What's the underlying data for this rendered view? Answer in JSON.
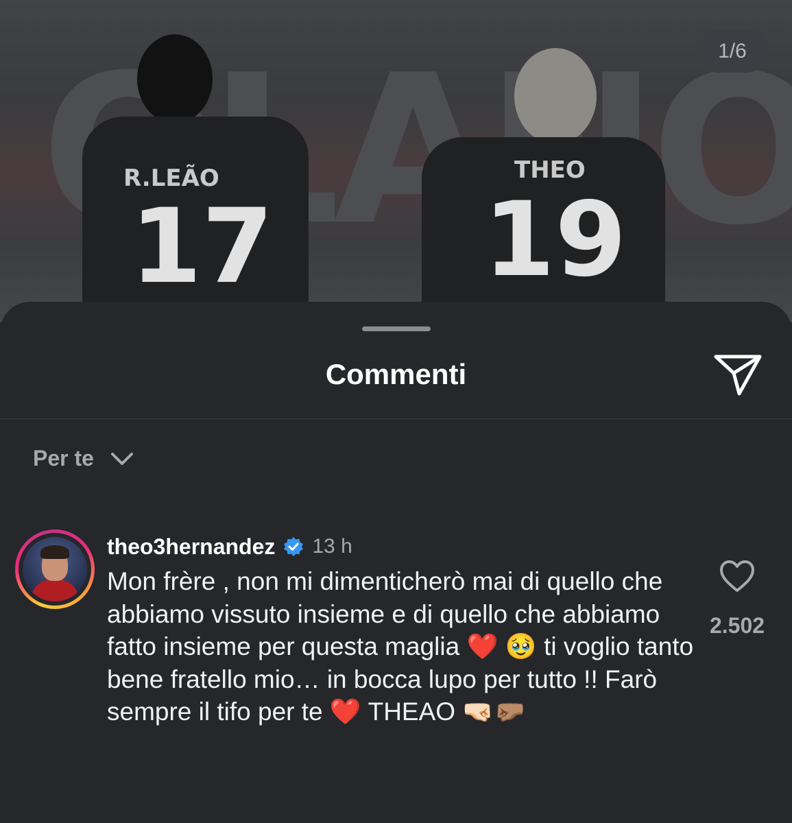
{
  "photo": {
    "counter": "1/6",
    "players": [
      {
        "name": "R.LEÃO",
        "number": "17"
      },
      {
        "name": "THEO",
        "number": "19"
      }
    ]
  },
  "sheet": {
    "title": "Commenti",
    "sort_label": "Per te"
  },
  "comment": {
    "username": "theo3hernandez",
    "time": "13 h",
    "text": "Mon frère , non mi dimenticherò mai di quello che abbiamo vissuto insieme e di quello che abbiamo fatto insieme per questa maglia ❤️ 🥹  ti voglio tanto bene fratello mio… in bocca lupo per tutto !! Farò sempre il tifo per te ❤️  THEAO 🤜🏻🤛🏽",
    "likes": "2.502"
  },
  "icons": {
    "send": "paper-plane-icon",
    "chevron": "chevron-down-icon",
    "verified": "verified-badge-icon",
    "like": "heart-outline-icon"
  },
  "colors": {
    "sheet_bg": "#25272b",
    "verified": "#3797f0",
    "secondary_text": "#a7a9ad"
  }
}
